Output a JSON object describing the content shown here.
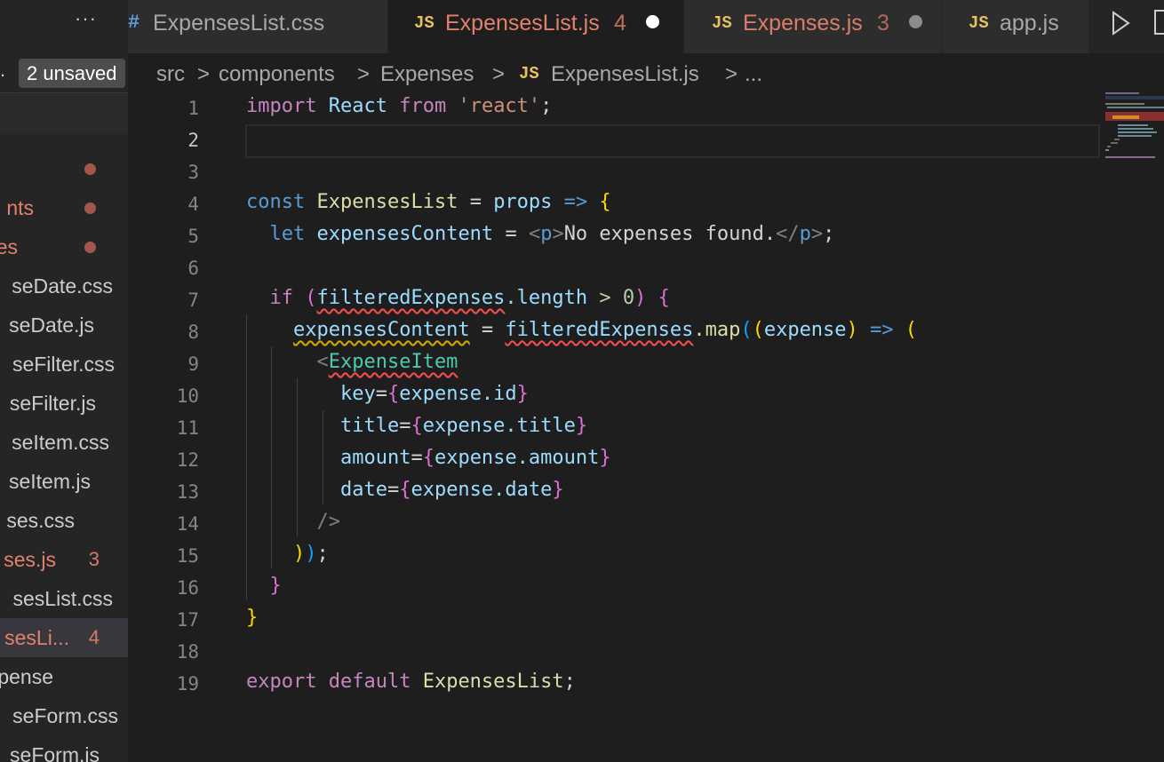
{
  "sidebar": {
    "more_label": "···",
    "dot_label": ".",
    "unsaved_label": "2 unsaved",
    "files": [
      {
        "name": "",
        "state": "modified-dot"
      },
      {
        "name": "nts",
        "state": "modified-dot"
      },
      {
        "name": "es",
        "state": "modified-dot"
      },
      {
        "name": "seDate.css",
        "state": "normal"
      },
      {
        "name": "seDate.js",
        "state": "normal"
      },
      {
        "name": "seFilter.css",
        "state": "normal"
      },
      {
        "name": "seFilter.js",
        "state": "normal"
      },
      {
        "name": "seItem.css",
        "state": "normal"
      },
      {
        "name": "seItem.js",
        "state": "normal"
      },
      {
        "name": "ses.css",
        "state": "normal"
      },
      {
        "name": "ses.js",
        "state": "modified",
        "badge": "3"
      },
      {
        "name": "sesList.css",
        "state": "normal"
      },
      {
        "name": "sesLi...",
        "state": "modified-active",
        "badge": "4"
      },
      {
        "name": "pense",
        "state": "normal"
      },
      {
        "name": "seForm.css",
        "state": "normal"
      },
      {
        "name": "seForm.js",
        "state": "normal"
      }
    ]
  },
  "tabs": {
    "more_label": "···",
    "items": [
      {
        "icon": "#",
        "label": "ExpensesList.css",
        "count": "",
        "state": "normal"
      },
      {
        "icon": "JS",
        "label": "ExpensesList.js",
        "count": "4",
        "state": "active-modified"
      },
      {
        "icon": "JS",
        "label": "Expenses.js",
        "count": "3",
        "state": "modified"
      },
      {
        "icon": "JS",
        "label": "app.js",
        "count": "",
        "state": "normal"
      }
    ]
  },
  "breadcrumb": {
    "items": [
      "src",
      "components",
      "Expenses",
      "ExpensesList.js",
      "..."
    ],
    "separator": ">",
    "file_icon": "JS"
  },
  "editor": {
    "current_line": 2,
    "lines": [
      {
        "n": "1",
        "text": "import React from 'react';"
      },
      {
        "n": "2",
        "text": ""
      },
      {
        "n": "3",
        "text": ""
      },
      {
        "n": "4",
        "text": "const ExpensesList = props => {"
      },
      {
        "n": "5",
        "text": "  let expensesContent = <p>No expenses found.</p>;"
      },
      {
        "n": "6",
        "text": ""
      },
      {
        "n": "7",
        "text": "  if (filteredExpenses.length > 0) {"
      },
      {
        "n": "8",
        "text": "    expensesContent = filteredExpenses.map((expense) => ("
      },
      {
        "n": "9",
        "text": "      <ExpenseItem"
      },
      {
        "n": "10",
        "text": "        key={expense.id}"
      },
      {
        "n": "11",
        "text": "        title={expense.title}"
      },
      {
        "n": "12",
        "text": "        amount={expense.amount}"
      },
      {
        "n": "13",
        "text": "        date={expense.date}"
      },
      {
        "n": "14",
        "text": "      />"
      },
      {
        "n": "15",
        "text": "    ));"
      },
      {
        "n": "16",
        "text": "  }"
      },
      {
        "n": "17",
        "text": "}"
      },
      {
        "n": "18",
        "text": ""
      },
      {
        "n": "19",
        "text": "export default ExpensesList;"
      }
    ]
  },
  "colors": {
    "background": "#1e1e1e",
    "sidebar": "#252526",
    "modified": "#e2816c",
    "js_icon": "#e5c15f",
    "error": "#f14c4c",
    "warning": "#cca700"
  }
}
